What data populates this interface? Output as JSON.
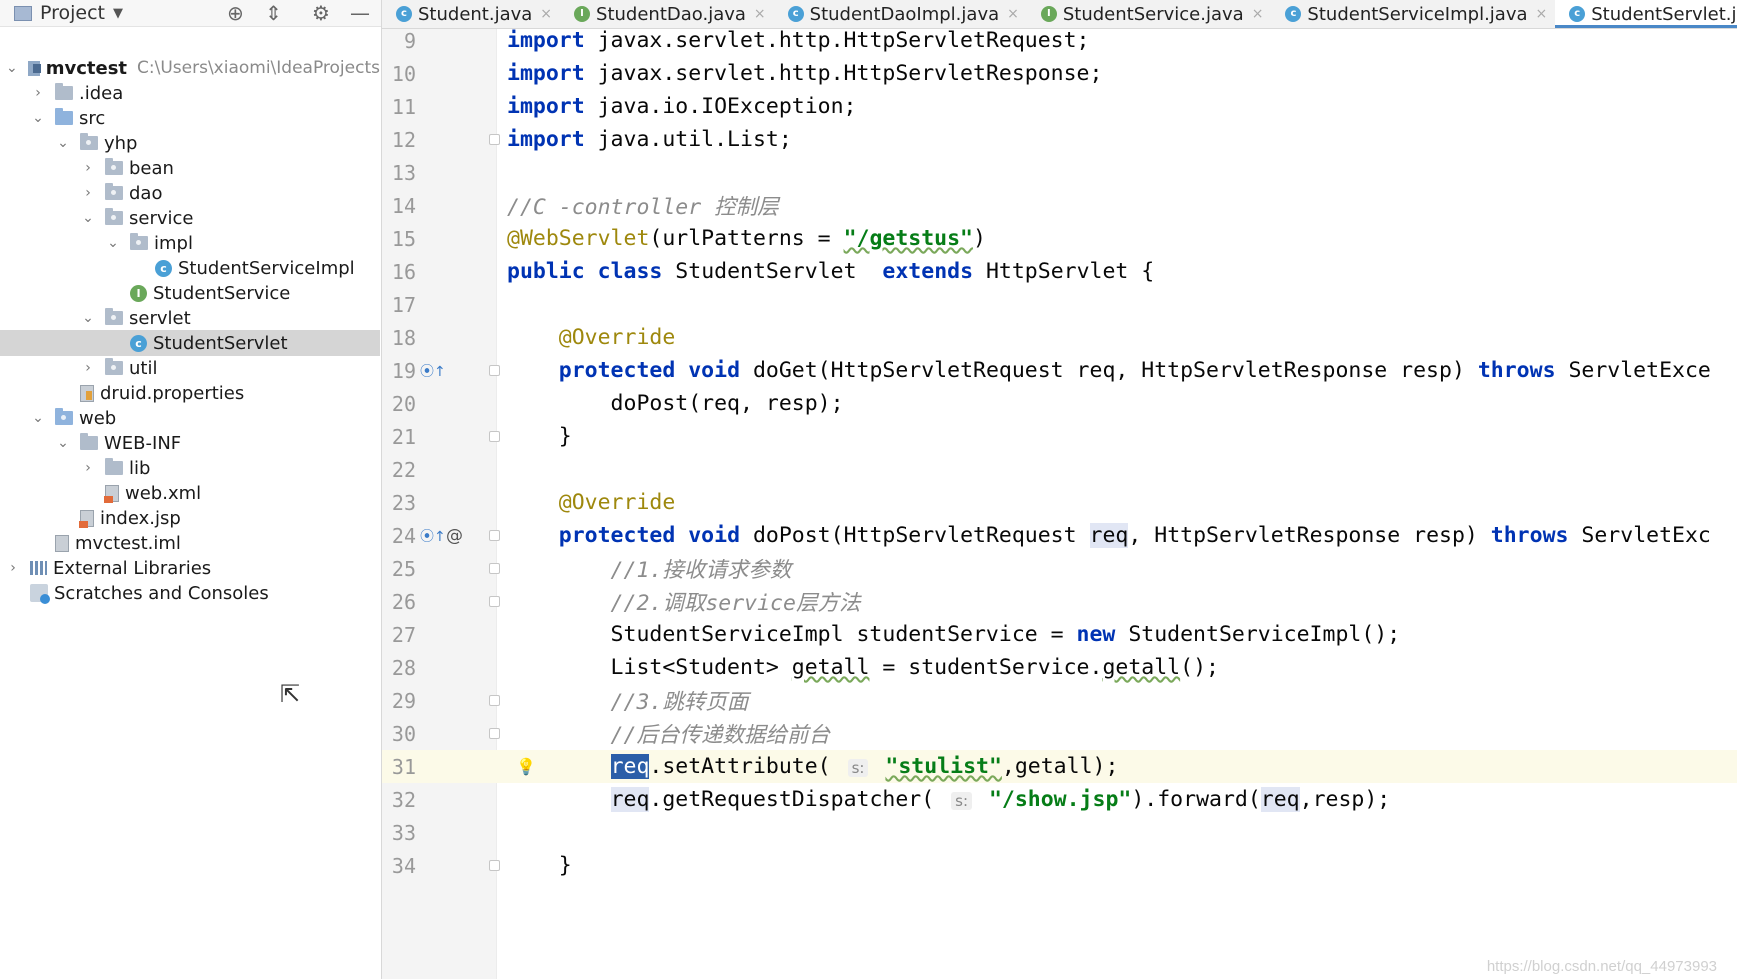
{
  "project_panel": {
    "title": "Project",
    "tree": [
      {
        "label": "mvctest",
        "path": "C:\\Users\\xiaomi\\IdeaProjects",
        "icon": "module-folder-icon",
        "expanded": true,
        "depth": 0
      },
      {
        "label": ".idea",
        "icon": "folder-icon",
        "expanded": false,
        "depth": 1
      },
      {
        "label": "src",
        "icon": "source-folder-icon",
        "expanded": true,
        "depth": 1
      },
      {
        "label": "yhp",
        "icon": "package-icon",
        "expanded": true,
        "depth": 2
      },
      {
        "label": "bean",
        "icon": "package-icon",
        "expanded": false,
        "depth": 3
      },
      {
        "label": "dao",
        "icon": "package-icon",
        "expanded": false,
        "depth": 3
      },
      {
        "label": "service",
        "icon": "package-icon",
        "expanded": true,
        "depth": 3
      },
      {
        "label": "impl",
        "icon": "package-icon",
        "expanded": true,
        "depth": 4
      },
      {
        "label": "StudentServiceImpl",
        "icon": "class-icon",
        "depth": 5
      },
      {
        "label": "StudentService",
        "icon": "interface-icon",
        "depth": 4
      },
      {
        "label": "servlet",
        "icon": "package-icon",
        "expanded": true,
        "depth": 3
      },
      {
        "label": "StudentServlet",
        "icon": "class-icon",
        "depth": 4,
        "selected": true
      },
      {
        "label": "util",
        "icon": "package-icon",
        "expanded": false,
        "depth": 3
      },
      {
        "label": "druid.properties",
        "icon": "properties-file-icon",
        "depth": 2
      },
      {
        "label": "web",
        "icon": "web-folder-icon",
        "expanded": true,
        "depth": 1
      },
      {
        "label": "WEB-INF",
        "icon": "folder-icon",
        "expanded": true,
        "depth": 2
      },
      {
        "label": "lib",
        "icon": "folder-icon",
        "expanded": false,
        "depth": 3
      },
      {
        "label": "web.xml",
        "icon": "xml-file-icon",
        "depth": 3
      },
      {
        "label": "index.jsp",
        "icon": "jsp-file-icon",
        "depth": 2
      },
      {
        "label": "mvctest.iml",
        "icon": "iml-file-icon",
        "depth": 1
      },
      {
        "label": "External Libraries",
        "icon": "libraries-icon",
        "expanded": false,
        "depth": 0
      },
      {
        "label": "Scratches and Consoles",
        "icon": "scratches-icon",
        "depth": 0
      }
    ]
  },
  "tabs": [
    {
      "label": "Student.java",
      "kind": "class",
      "closable": true
    },
    {
      "label": "StudentDao.java",
      "kind": "interface",
      "closable": true
    },
    {
      "label": "StudentDaoImpl.java",
      "kind": "class",
      "closable": true
    },
    {
      "label": "StudentService.java",
      "kind": "interface",
      "closable": true
    },
    {
      "label": "StudentServiceImpl.java",
      "kind": "class",
      "closable": true
    },
    {
      "label": "StudentServlet.java",
      "kind": "class",
      "closable": true,
      "active": true
    }
  ],
  "editor": {
    "current_line": 31,
    "watermark": "https://blog.csdn.net/qq_44973993",
    "lines": [
      {
        "n": "9",
        "text": "import javax.servlet.http.HttpServletRequest;"
      },
      {
        "n": "10",
        "text": "import javax.servlet.http.HttpServletResponse;"
      },
      {
        "n": "11",
        "text": "import java.io.IOException;"
      },
      {
        "n": "12",
        "text": "import java.util.List;"
      },
      {
        "n": "13",
        "text": ""
      },
      {
        "n": "14",
        "text": "//C -controller 控制层"
      },
      {
        "n": "15",
        "text": "@WebServlet(urlPatterns = \"/getstus\")"
      },
      {
        "n": "16",
        "text": "public class StudentServlet  extends HttpServlet {"
      },
      {
        "n": "17",
        "text": ""
      },
      {
        "n": "18",
        "text": "    @Override"
      },
      {
        "n": "19",
        "text": "    protected void doGet(HttpServletRequest req, HttpServletResponse resp) throws ServletExce"
      },
      {
        "n": "20",
        "text": "        doPost(req, resp);"
      },
      {
        "n": "21",
        "text": "    }"
      },
      {
        "n": "22",
        "text": ""
      },
      {
        "n": "23",
        "text": "    @Override"
      },
      {
        "n": "24",
        "text": "    protected void doPost(HttpServletRequest req, HttpServletResponse resp) throws ServletExc"
      },
      {
        "n": "25",
        "text": "        //1.接收请求参数"
      },
      {
        "n": "26",
        "text": "        //2.调取service层方法"
      },
      {
        "n": "27",
        "text": "        StudentServiceImpl studentService = new StudentServiceImpl();"
      },
      {
        "n": "28",
        "text": "        List<Student> getall = studentService.getall();"
      },
      {
        "n": "29",
        "text": "        //3.跳转页面"
      },
      {
        "n": "30",
        "text": "        //后台传递数据给前台"
      },
      {
        "n": "31",
        "text": "        req.setAttribute( s: \"stulist\",getall);"
      },
      {
        "n": "32",
        "text": "        req.getRequestDispatcher( s: \"/show.jsp\").forward(req,resp);"
      },
      {
        "n": "33",
        "text": ""
      },
      {
        "n": "34",
        "text": "    }"
      }
    ],
    "param_hint": "s:"
  }
}
